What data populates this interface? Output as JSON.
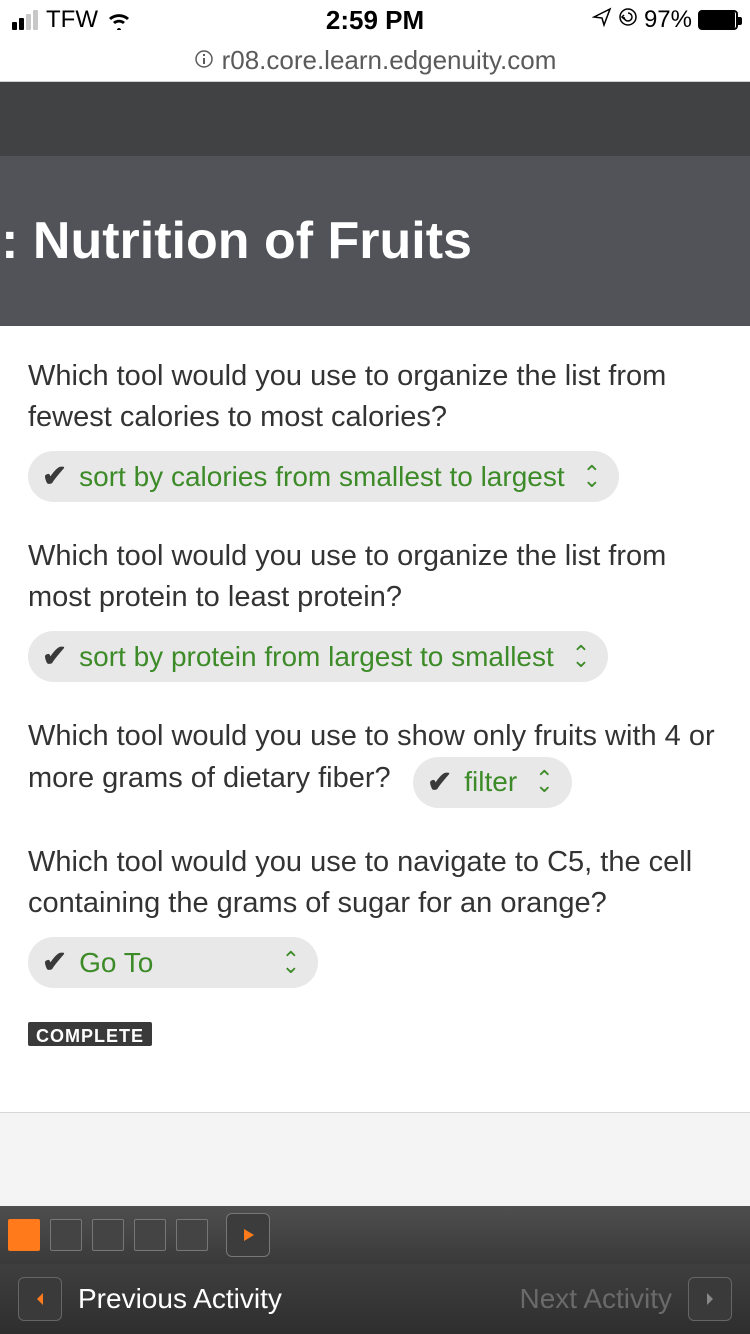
{
  "status": {
    "carrier": "TFW",
    "time": "2:59 PM",
    "battery_pct": "97%"
  },
  "url": "r08.core.learn.edgenuity.com",
  "page_title": "ios: Nutrition of Fruits",
  "questions": [
    {
      "prompt": "Which tool would you use to organize the list from fewest calories to most calories?",
      "answer": "sort by calories from smallest to largest"
    },
    {
      "prompt": "Which tool would you use to organize the list from most protein to least protein?",
      "answer": "sort by protein from largest to smallest"
    },
    {
      "prompt": "Which tool would you use to show only fruits with 4 or more grams of dietary fiber?",
      "answer": "filter"
    },
    {
      "prompt": "Which tool would you use to navigate to C5, the cell containing the grams of sugar for an orange?",
      "answer": "Go To"
    }
  ],
  "complete_label": "COMPLETE",
  "nav": {
    "prev": "Previous Activity",
    "next": "Next Activity"
  }
}
